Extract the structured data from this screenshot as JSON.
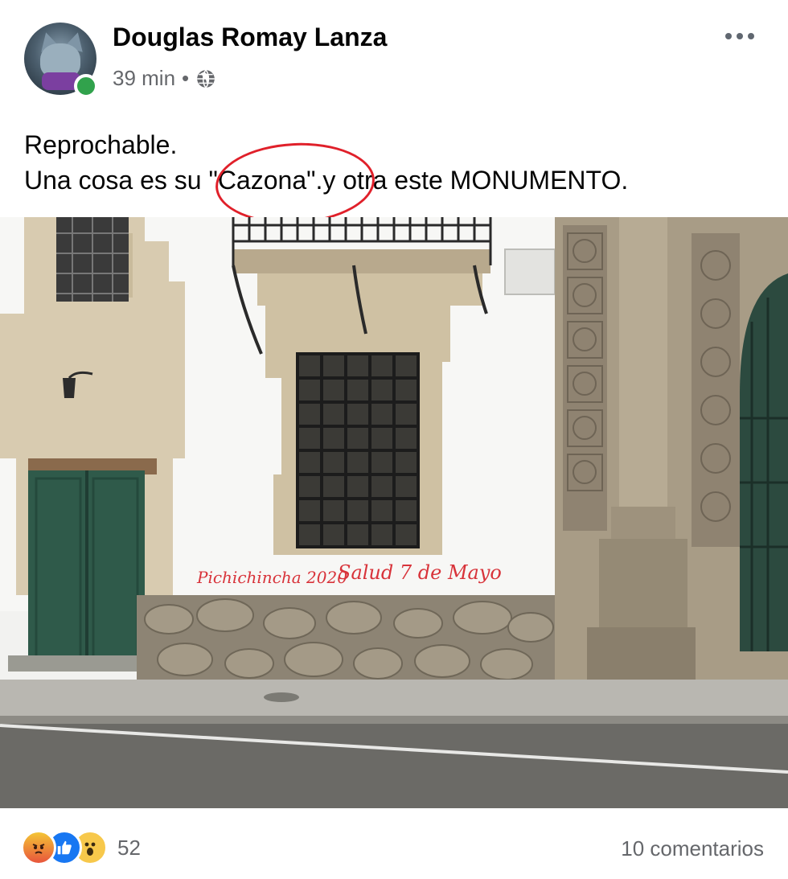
{
  "post": {
    "author": "Douglas Romay Lanza",
    "time": "39 min",
    "separator": "•",
    "text_line1": "Reprochable.",
    "text_line2": "Una cosa es su \"Cazona\".y otra este MONUMENTO."
  },
  "photo": {
    "graffiti_1": "Pichichincha 2020",
    "graffiti_2": "Salud 7 de Mayo"
  },
  "footer": {
    "reaction_count": "52",
    "comments_label": "10 comentarios",
    "reactions": [
      "angry",
      "like",
      "wow"
    ]
  },
  "colors": {
    "accent": "#1877f2",
    "online": "#31a24c",
    "annotation": "#e0202a"
  }
}
